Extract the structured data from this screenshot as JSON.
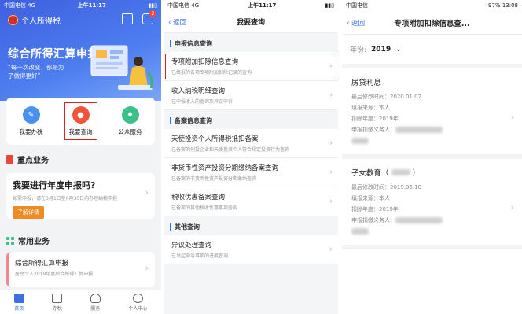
{
  "panel1": {
    "status": {
      "carrier": "中国电信 4G",
      "time": "上午11:17"
    },
    "app_title": "个人所得税",
    "chat_badge": "2",
    "banner": {
      "title": "综合所得汇算申报",
      "subtitle": "“每一次改变，都是为了做得更好”"
    },
    "quick_actions": [
      {
        "label": "我要办税",
        "color": "#4a90f0"
      },
      {
        "label": "我要查询",
        "color": "#f0553c"
      },
      {
        "label": "公众服务",
        "color": "#3cc08a"
      }
    ],
    "key_business": {
      "section": "重点业务",
      "title": "我要进行年度申报吗?",
      "desc": "如需申报，请在3月1日至6月30日内办理纳税申报",
      "button": "了解详情"
    },
    "common_business": {
      "section": "常用业务",
      "title": "综合所得汇算申报",
      "desc": "居民个人2019年度综合所得汇算申报"
    },
    "tabs": [
      {
        "label": "首页",
        "active": true
      },
      {
        "label": "办税",
        "active": false
      },
      {
        "label": "服务",
        "active": false
      },
      {
        "label": "个人中心",
        "active": false
      }
    ]
  },
  "panel2": {
    "status": {
      "carrier": "中国电信 4G",
      "time": "上午11:17"
    },
    "back": "返回",
    "title": "我要查询",
    "groups": [
      {
        "heading": "申报信息查询",
        "items": [
          {
            "title": "专项附加扣除信息查询",
            "desc": "已填报的各项专项附加扣除记录的查询",
            "highlight": true
          },
          {
            "title": "收入纳税明细查询",
            "desc": "已申报收入的查询及异议申诉",
            "highlight": false
          }
        ]
      },
      {
        "heading": "备案信息查询",
        "items": [
          {
            "title": "天使投资个人所得税抵扣备案",
            "desc": "已备案的创投企业和天使投资个人符合规定投资行为查询",
            "highlight": false
          },
          {
            "title": "非货币性资产投资分期缴纳备案查询",
            "desc": "已备案的非货币性资产投资分期缴纳查询",
            "highlight": false
          },
          {
            "title": "税收优惠备案查询",
            "desc": "已备案的其他税收优惠事项查询",
            "highlight": false
          }
        ]
      },
      {
        "heading": "其他查询",
        "items": [
          {
            "title": "异议处理查询",
            "desc": "已发起申诉事项的进度查询",
            "highlight": false
          }
        ]
      }
    ]
  },
  "panel3": {
    "status": {
      "left": "中国电信",
      "right": "97% 13:08"
    },
    "back": "返回",
    "title": "专项附加扣除信息查...",
    "year_label": "年份:",
    "year_value": "2019",
    "records": [
      {
        "title": "房贷利息",
        "lines": [
          "最后修改时间：2020.01.02",
          "填报来源：本人",
          "扣除年度：2019年",
          "申报扣缴义务人："
        ]
      },
      {
        "title": "子女教育（",
        "lines": [
          "最后修改时间：2019.06.10",
          "填报来源：本人",
          "扣除年度：2019年",
          "申报扣缴义务人："
        ]
      }
    ]
  }
}
